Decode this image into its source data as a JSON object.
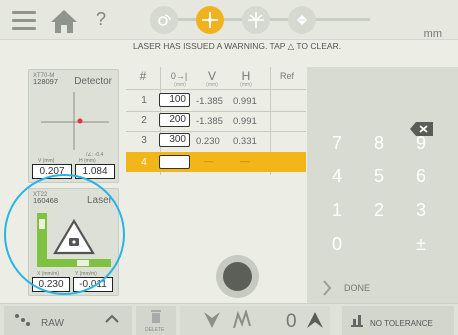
{
  "header": {
    "unit": "mm",
    "help_symbol": "?"
  },
  "warning": "LASER HAS ISSUED A WARNING. TAP △ TO CLEAR.",
  "detector": {
    "model": "XT70-M",
    "serial": "128097",
    "title": "Detector",
    "angle_label": "/∠: -0.4",
    "v_label": "V (mm)",
    "h_label": "H (mm)",
    "v_value": "0.207",
    "h_value": "1.084"
  },
  "laser": {
    "model": "XT22",
    "serial": "160468",
    "title": "Laser",
    "x_label": "X (mm/m)",
    "y_label": "Y (mm/m)",
    "x_value": "0.230",
    "y_value": "-0.011"
  },
  "table": {
    "headers": [
      "#",
      "0→|",
      "V",
      "H",
      "Ref"
    ],
    "subheaders": [
      "(mm)",
      "(mm)",
      "(mm)"
    ],
    "rows": [
      {
        "num": "1",
        "dist": "100",
        "v": "-1.385",
        "h": "0.991"
      },
      {
        "num": "2",
        "dist": "200",
        "v": "-1.385",
        "h": "0.991"
      },
      {
        "num": "3",
        "dist": "300",
        "v": "0.230",
        "h": "0.331"
      },
      {
        "num": "4",
        "dist": "",
        "v": "—",
        "h": "—"
      }
    ]
  },
  "keypad": {
    "keys": [
      "7",
      "8",
      "9",
      "4",
      "5",
      "6",
      "1",
      "2",
      "3",
      "0",
      "±"
    ],
    "done_label": "DONE"
  },
  "bottom": {
    "raw_label": "RAW",
    "delete_label": "DELETE",
    "zero_count": "0",
    "tolerance_label": "NO TOLERANCE"
  },
  "colors": {
    "accent": "#f2b619",
    "highlight": "#28b4e6",
    "laser_green": "#7fc241"
  }
}
